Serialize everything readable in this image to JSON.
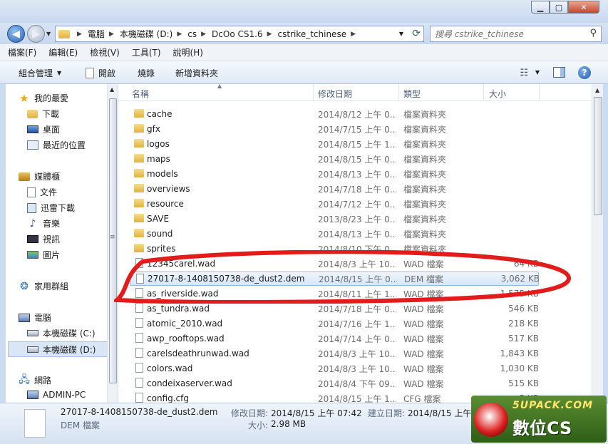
{
  "address": {
    "crumbs": [
      "電腦",
      "本機磁碟 (D:)",
      "cs",
      "DcOo CS1.6",
      "cstrike_tchinese"
    ],
    "search_placeholder": "搜尋 cstrike_tchinese"
  },
  "menu": [
    "檔案(F)",
    "編輯(E)",
    "檢視(V)",
    "工具(T)",
    "說明(H)"
  ],
  "toolbar": {
    "organize": "組合管理",
    "open": "開啟",
    "burn": "燒錄",
    "new_folder": "新增資料夾"
  },
  "nav": {
    "favorites": "我的最愛",
    "downloads": "下載",
    "desktop": "桌面",
    "recent": "最近的位置",
    "libraries": "媒體櫃",
    "documents": "文件",
    "thunder": "迅雷下載",
    "music": "音樂",
    "videos": "視訊",
    "pictures": "圖片",
    "homegroup": "家用群組",
    "computer": "電腦",
    "drive_c": "本機磁碟 (C:)",
    "drive_d": "本機磁碟 (D:)",
    "network": "網路",
    "admin_pc": "ADMIN-PC"
  },
  "columns": {
    "name": "名稱",
    "date": "修改日期",
    "type": "類型",
    "size": "大小"
  },
  "files": [
    {
      "name": "cache",
      "date": "2014/8/12 上午 0...",
      "type": "檔案資料夾",
      "size": "",
      "kind": "folder"
    },
    {
      "name": "gfx",
      "date": "2014/7/15 上午 0...",
      "type": "檔案資料夾",
      "size": "",
      "kind": "folder"
    },
    {
      "name": "logos",
      "date": "2014/8/15 上午 1...",
      "type": "檔案資料夾",
      "size": "",
      "kind": "folder"
    },
    {
      "name": "maps",
      "date": "2014/8/15 上午 0...",
      "type": "檔案資料夾",
      "size": "",
      "kind": "folder"
    },
    {
      "name": "models",
      "date": "2014/8/13 上午 0...",
      "type": "檔案資料夾",
      "size": "",
      "kind": "folder"
    },
    {
      "name": "overviews",
      "date": "2014/7/18 上午 0...",
      "type": "檔案資料夾",
      "size": "",
      "kind": "folder"
    },
    {
      "name": "resource",
      "date": "2014/7/12 上午 0...",
      "type": "檔案資料夾",
      "size": "",
      "kind": "folder"
    },
    {
      "name": "SAVE",
      "date": "2013/8/23 上午 0...",
      "type": "檔案資料夾",
      "size": "",
      "kind": "folder"
    },
    {
      "name": "sound",
      "date": "2014/8/13 上午 0...",
      "type": "檔案資料夾",
      "size": "",
      "kind": "folder"
    },
    {
      "name": "sprites",
      "date": "2014/8/10 下午 0...",
      "type": "檔案資料夾",
      "size": "",
      "kind": "folder"
    },
    {
      "name": "12345carel.wad",
      "date": "2014/8/3 上午 10...",
      "type": "WAD 檔案",
      "size": "64 KB",
      "kind": "file"
    },
    {
      "name": "27017-8-1408150738-de_dust2.dem",
      "date": "2014/8/15 上午 0...",
      "type": "DEM 檔案",
      "size": "3,062 KB",
      "kind": "file",
      "selected": true
    },
    {
      "name": "as_riverside.wad",
      "date": "2014/8/11 上午 1...",
      "type": "WAD 檔案",
      "size": "1,575 KB",
      "kind": "file"
    },
    {
      "name": "as_tundra.wad",
      "date": "2014/7/18 上午 0...",
      "type": "WAD 檔案",
      "size": "546 KB",
      "kind": "file"
    },
    {
      "name": "atomic_2010.wad",
      "date": "2014/7/16 上午 1...",
      "type": "WAD 檔案",
      "size": "218 KB",
      "kind": "file"
    },
    {
      "name": "awp_rooftops.wad",
      "date": "2014/7/14 上午 0...",
      "type": "WAD 檔案",
      "size": "517 KB",
      "kind": "file"
    },
    {
      "name": "carelsdeathrunwad.wad",
      "date": "2014/8/3 上午 10...",
      "type": "WAD 檔案",
      "size": "1,843 KB",
      "kind": "file"
    },
    {
      "name": "colors.wad",
      "date": "2014/8/3 上午 10...",
      "type": "WAD 檔案",
      "size": "1,030 KB",
      "kind": "file"
    },
    {
      "name": "condeixaserver.wad",
      "date": "2014/8/4 下午 09...",
      "type": "WAD 檔案",
      "size": "515 KB",
      "kind": "file"
    },
    {
      "name": "config.cfg",
      "date": "2014/8/15 上午 1...",
      "type": "CFG 檔案",
      "size": "5 KB",
      "kind": "file"
    }
  ],
  "details": {
    "filename": "27017-8-1408150738-de_dust2.dem",
    "filetype": "DEM 檔案",
    "modified_label": "修改日期:",
    "modified_value": "2014/8/15 上午 07:42",
    "created_label": "建立日期:",
    "created_value": "2014/8/15 上午 08:51",
    "size_label": "大小:",
    "size_value": "2.98 MB"
  },
  "watermark": {
    "site": "5UPACK.COM",
    "brand": "數位CS"
  }
}
